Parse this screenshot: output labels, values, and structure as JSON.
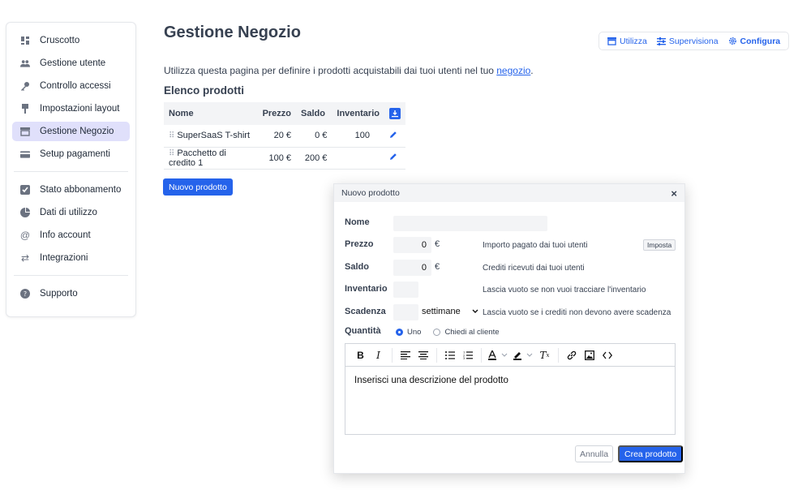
{
  "sidebar": {
    "items": [
      {
        "label": "Cruscotto",
        "icon": "dashboard-icon"
      },
      {
        "label": "Gestione utente",
        "icon": "users-icon"
      },
      {
        "label": "Controllo accessi",
        "icon": "key-icon"
      },
      {
        "label": "Impostazioni layout",
        "icon": "brush-icon"
      },
      {
        "label": "Gestione Negozio",
        "icon": "store-icon",
        "active": true
      },
      {
        "label": "Setup pagamenti",
        "icon": "credit-card-icon"
      },
      {
        "label": "Stato abbonamento",
        "icon": "checkbox-icon"
      },
      {
        "label": "Dati di utilizzo",
        "icon": "pie-chart-icon"
      },
      {
        "label": "Info account",
        "icon": "at-icon"
      },
      {
        "label": "Integrazioni",
        "icon": "arrows-icon"
      },
      {
        "label": "Supporto",
        "icon": "help-icon"
      }
    ]
  },
  "header": {
    "title": "Gestione Negozio",
    "tabs": {
      "use": "Utilizza",
      "supervise": "Supervisiona",
      "configure": "Configura"
    }
  },
  "intro": {
    "text": "Utilizza questa pagina per definire i prodotti acquistabili dai tuoi utenti nel tuo ",
    "link": "negozio",
    "end": "."
  },
  "products": {
    "title": "Elenco prodotti",
    "columns": {
      "name": "Nome",
      "price": "Prezzo",
      "balance": "Saldo",
      "inventory": "Inventario"
    },
    "rows": [
      {
        "name": "SuperSaaS T-shirt",
        "price": "20 €",
        "balance": "0 €",
        "inventory": "100"
      },
      {
        "name": "Pacchetto di credito 1",
        "price": "100 €",
        "balance": "200 €",
        "inventory": ""
      }
    ],
    "new_button": "Nuovo prodotto"
  },
  "modal": {
    "title": "Nuovo prodotto",
    "close": "×",
    "labels": {
      "name": "Nome",
      "price": "Prezzo",
      "balance": "Saldo",
      "inventory": "Inventario",
      "expiry": "Scadenza",
      "quantity": "Quantità"
    },
    "values": {
      "name": "",
      "price": "0",
      "balance": "0",
      "inventory": "",
      "expiry": "",
      "expiry_unit": "settimane"
    },
    "currency": "€",
    "hints": {
      "price": "Importo pagato dai tuoi utenti",
      "balance": "Crediti ricevuti dai tuoi utenti",
      "inventory": "Lascia vuoto se non vuoi tracciare l'inventario",
      "expiry": "Lascia vuoto se i crediti non devono avere scadenza"
    },
    "set_button": "Imposta",
    "quantity_options": {
      "one": "Uno",
      "ask": "Chiedi al cliente",
      "selected": "Uno"
    },
    "editor_placeholder": "Inserisci una descrizione del prodotto",
    "cancel": "Annulla",
    "create": "Crea prodotto"
  },
  "colors": {
    "accent": "#2563eb",
    "active_nav": "#e0e0fb",
    "header_bg": "#f3f4f6"
  }
}
